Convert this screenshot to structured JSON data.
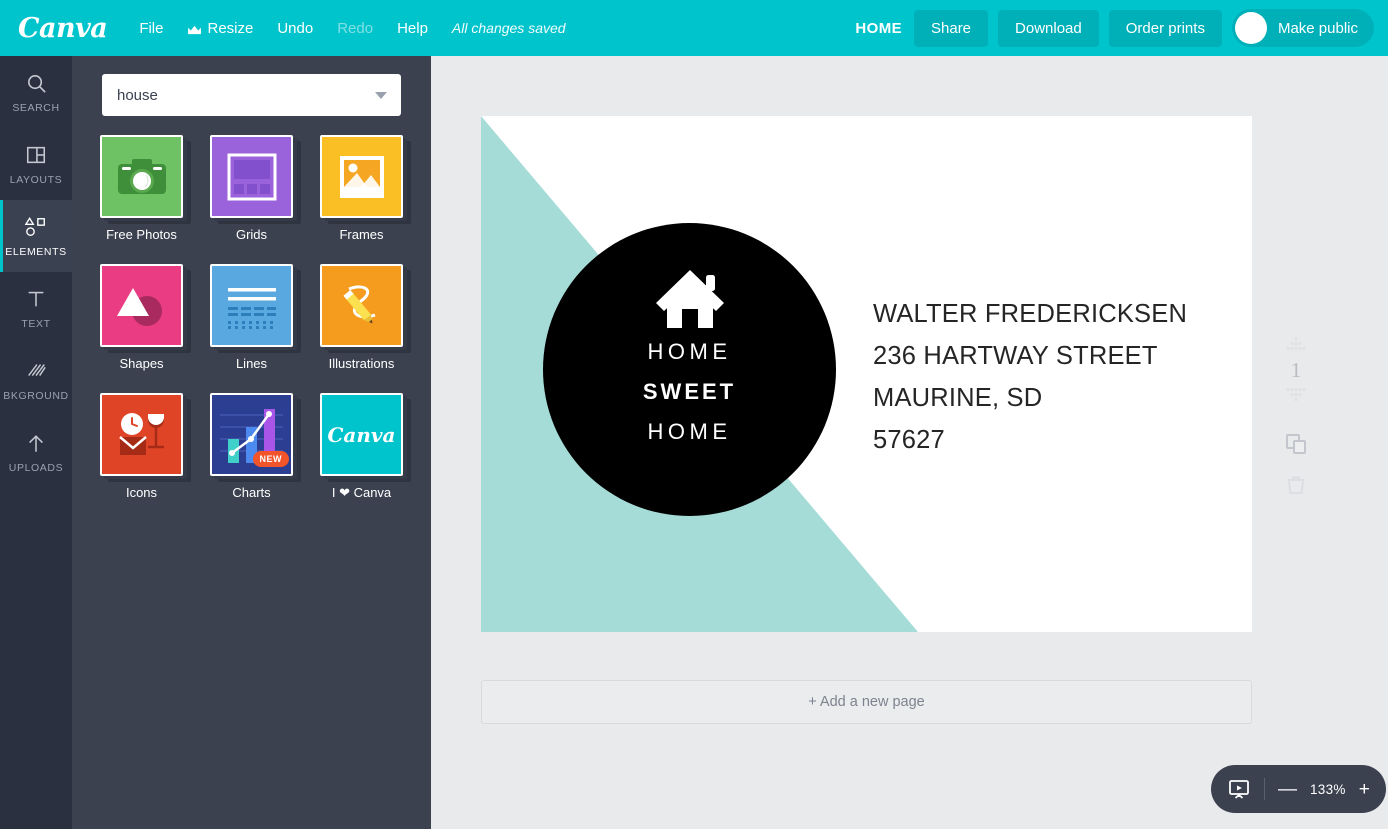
{
  "topbar": {
    "logo": "Canva",
    "menu": [
      {
        "label": "File",
        "icon": null,
        "dim": false
      },
      {
        "label": "Resize",
        "icon": "crown-icon",
        "dim": false
      },
      {
        "label": "Undo",
        "icon": null,
        "dim": false
      },
      {
        "label": "Redo",
        "icon": null,
        "dim": true
      },
      {
        "label": "Help",
        "icon": null,
        "dim": false
      }
    ],
    "save_status": "All changes saved",
    "home_label": "HOME",
    "share_label": "Share",
    "download_label": "Download",
    "order_prints_label": "Order prints",
    "make_public_label": "Make public",
    "accent_color": "#00c4cc",
    "button_color": "#00b0b9"
  },
  "rail": {
    "items": [
      {
        "label": "SEARCH",
        "icon": "search-icon",
        "active": false
      },
      {
        "label": "LAYOUTS",
        "icon": "layouts-icon",
        "active": false
      },
      {
        "label": "ELEMENTS",
        "icon": "elements-icon",
        "active": true
      },
      {
        "label": "TEXT",
        "icon": "text-icon",
        "active": false
      },
      {
        "label": "BKGROUND",
        "icon": "background-icon",
        "active": false
      },
      {
        "label": "UPLOADS",
        "icon": "upload-icon",
        "active": false
      }
    ],
    "background_color": "#2a3040",
    "active_accent": "#00c4cc"
  },
  "panel": {
    "search": {
      "value": "house",
      "placeholder": "Search",
      "caret_icon": "chevron-down-icon"
    },
    "tiles": [
      {
        "label": "Free Photos",
        "icon": "camera-icon",
        "color": "#6ec263",
        "badge": null
      },
      {
        "label": "Grids",
        "icon": "grid-icon",
        "color": "#9b63db",
        "badge": null
      },
      {
        "label": "Frames",
        "icon": "frame-icon",
        "color": "#f9bf24",
        "badge": null
      },
      {
        "label": "Shapes",
        "icon": "shapes-icon",
        "color": "#ea3c82",
        "badge": null
      },
      {
        "label": "Lines",
        "icon": "lines-icon",
        "color": "#59a9e0",
        "badge": null
      },
      {
        "label": "Illustrations",
        "icon": "pencil-icon",
        "color": "#f59b1e",
        "badge": null
      },
      {
        "label": "Icons",
        "icon": "icons-icon",
        "color": "#e04426",
        "badge": null
      },
      {
        "label": "Charts",
        "icon": "chart-icon",
        "color": "#2c3e92",
        "badge": "NEW"
      },
      {
        "label": "I ❤ Canva",
        "icon": "canva-heart-icon",
        "color": "#00c4cc",
        "badge": null
      }
    ],
    "background_color": "#3b414f"
  },
  "design": {
    "background_color": "#ffffff",
    "accent_color": "#a5dcd8",
    "badge": {
      "icon": "house-icon",
      "lines": [
        {
          "text": "HOME",
          "bold": false
        },
        {
          "text": "SWEET",
          "bold": true
        },
        {
          "text": "HOME",
          "bold": false
        }
      ],
      "circle_color": "#000000"
    },
    "address": [
      "WALTER FREDERICKSEN",
      "236 HARTWAY STREET",
      "MAURINE, SD",
      "57627"
    ]
  },
  "workspace": {
    "add_page_label": "+ Add a new page",
    "background_color": "#e9eaec"
  },
  "page_tools": {
    "move_up_icon": "move-up-icon",
    "page_number": "1",
    "move_down_icon": "move-down-icon",
    "duplicate_icon": "duplicate-icon",
    "delete_icon": "trash-icon"
  },
  "zoombar": {
    "present_icon": "present-icon",
    "zoom_out_label": "—",
    "zoom_level": "133%",
    "zoom_in_label": "+",
    "background_color": "#3b414f"
  }
}
